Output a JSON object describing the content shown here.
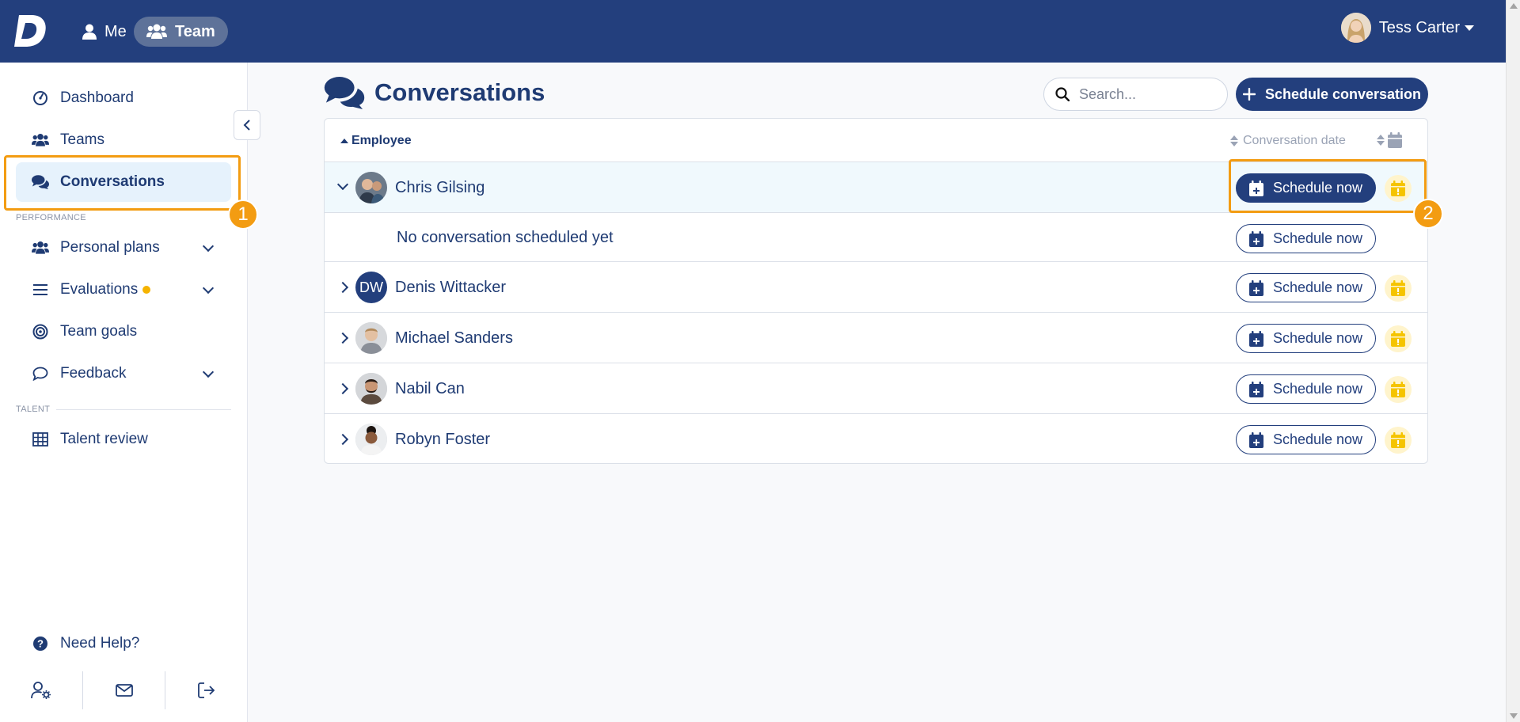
{
  "topbar": {
    "nav_me": "Me",
    "nav_team": "Team",
    "user_name": "Tess Carter",
    "brand_color": "#233f7d"
  },
  "sidebar": {
    "items": [
      {
        "label": "Dashboard",
        "icon": "gauge-icon"
      },
      {
        "label": "Teams",
        "icon": "users-icon"
      },
      {
        "label": "Conversations",
        "icon": "comments-icon",
        "active": true
      }
    ],
    "section_performance": "PERFORMANCE",
    "performance_items": [
      {
        "label": "Personal plans",
        "icon": "users-icon"
      },
      {
        "label": "Evaluations",
        "icon": "list-icon"
      },
      {
        "label": "Team goals",
        "icon": "target-icon"
      },
      {
        "label": "Feedback",
        "icon": "speech-bubble-icon"
      }
    ],
    "section_talent": "TALENT",
    "talent_items": [
      {
        "label": "Talent review",
        "icon": "grid-icon"
      }
    ],
    "help_label": "Need Help?"
  },
  "annotations": {
    "badge1": "1",
    "badge2": "2",
    "color": "#f39c12"
  },
  "main": {
    "title": "Conversations",
    "search_placeholder": "Search...",
    "schedule_conversation_label": "Schedule conversation",
    "table": {
      "col_employee": "Employee",
      "col_date": "Conversation date",
      "schedule_label": "Schedule now",
      "rows": [
        {
          "name": "Chris Gilsing",
          "expanded": true,
          "sub_text": "No conversation scheduled yet"
        },
        {
          "name": "Denis Wittacker",
          "initials": "DW"
        },
        {
          "name": "Michael Sanders"
        },
        {
          "name": "Nabil Can"
        },
        {
          "name": "Robyn Foster"
        }
      ]
    }
  }
}
